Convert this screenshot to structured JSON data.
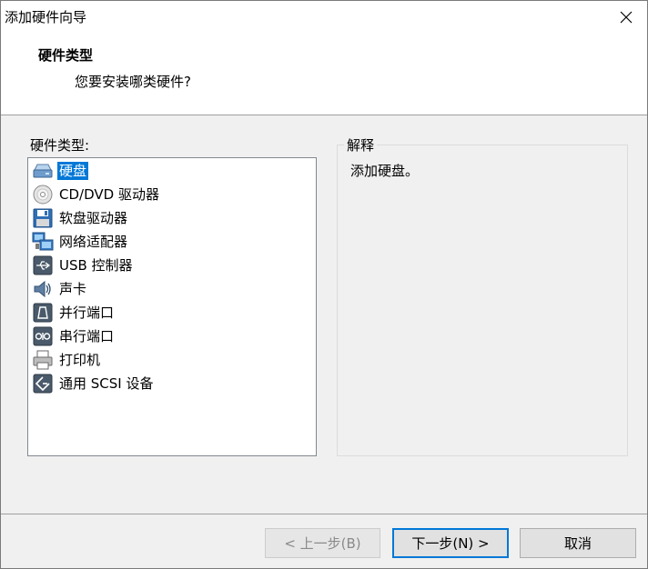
{
  "window": {
    "title": "添加硬件向导"
  },
  "header": {
    "title": "硬件类型",
    "subtitle": "您要安装哪类硬件?"
  },
  "list": {
    "label": "硬件类型:",
    "items": [
      {
        "label": "硬盘",
        "icon": "hard-disk-icon",
        "selected": true
      },
      {
        "label": "CD/DVD 驱动器",
        "icon": "cd-dvd-icon",
        "selected": false
      },
      {
        "label": "软盘驱动器",
        "icon": "floppy-icon",
        "selected": false
      },
      {
        "label": "网络适配器",
        "icon": "network-adapter-icon",
        "selected": false
      },
      {
        "label": "USB 控制器",
        "icon": "usb-icon",
        "selected": false
      },
      {
        "label": "声卡",
        "icon": "speaker-icon",
        "selected": false
      },
      {
        "label": "并行端口",
        "icon": "parallel-port-icon",
        "selected": false
      },
      {
        "label": "串行端口",
        "icon": "serial-port-icon",
        "selected": false
      },
      {
        "label": "打印机",
        "icon": "printer-icon",
        "selected": false
      },
      {
        "label": "通用 SCSI 设备",
        "icon": "scsi-icon",
        "selected": false
      }
    ]
  },
  "description": {
    "legend": "解释",
    "text": "添加硬盘。"
  },
  "buttons": {
    "back": "< 上一步(B)",
    "next": "下一步(N) >",
    "cancel": "取消"
  },
  "colors": {
    "selection": "#0078d7",
    "default_button_border": "#0078d7"
  }
}
